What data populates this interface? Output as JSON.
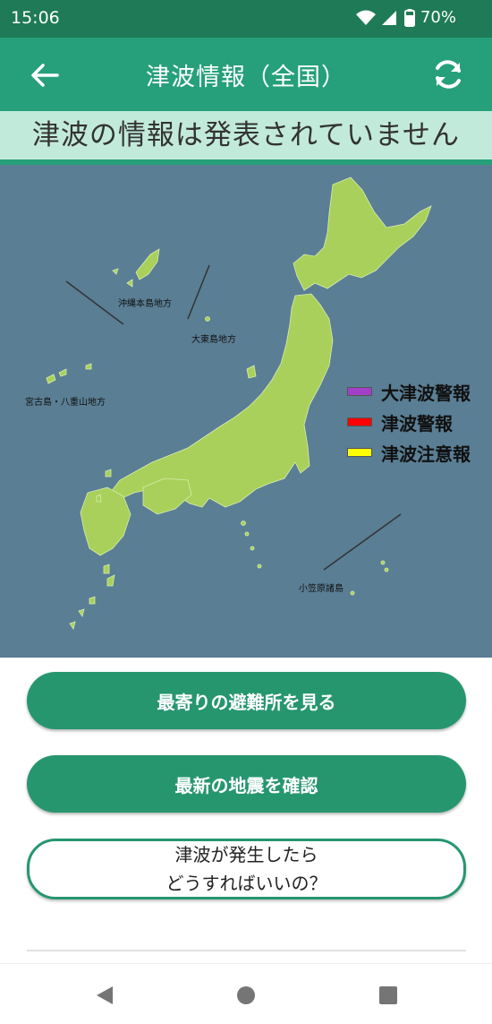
{
  "status_bar": {
    "time": "15:06",
    "battery": "70%"
  },
  "app_bar": {
    "title": "津波情報（全国）"
  },
  "notice": "津波の情報は発表されていません",
  "map": {
    "regions": {
      "okinawa": "沖縄本島地方",
      "daito": "大東島地方",
      "miyako": "宮古島・八重山地方",
      "ogasawara": "小笠原諸島"
    },
    "legend": [
      {
        "label": "大津波警報",
        "color": "#a23fc7"
      },
      {
        "label": "津波警報",
        "color": "#ff0000"
      },
      {
        "label": "津波注意報",
        "color": "#ffff00"
      }
    ],
    "land_color": "#a9d05a",
    "sea_color": "#5a7e94"
  },
  "buttons": {
    "shelter": "最寄りの避難所を見る",
    "earthquake": "最新の地震を確認",
    "howto_line1": "津波が発生したら",
    "howto_line2": "どうすればいいの？"
  },
  "accent_color": "#26a07a"
}
